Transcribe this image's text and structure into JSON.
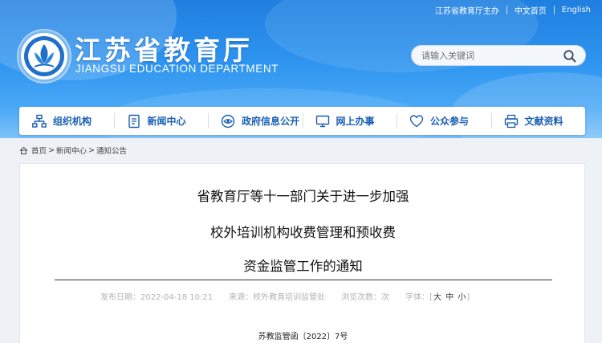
{
  "topbar": {
    "sponsor": "江苏省教育厅主办",
    "links": [
      "中文首页",
      "English"
    ]
  },
  "site": {
    "title": "江苏省教育厅",
    "subtitle": "JIANGSU EDUCATION DEPARTMENT"
  },
  "search": {
    "placeholder": "请输入关键词"
  },
  "nav": {
    "items": [
      {
        "label": "组织机构",
        "icon": "org-chart-icon"
      },
      {
        "label": "新闻中心",
        "icon": "document-icon"
      },
      {
        "label": "政府信息公开",
        "icon": "eye-icon"
      },
      {
        "label": "网上办事",
        "icon": "monitor-icon"
      },
      {
        "label": "公众参与",
        "icon": "heart-icon"
      },
      {
        "label": "文献资料",
        "icon": "printer-icon"
      }
    ]
  },
  "breadcrumb": {
    "items": [
      "首页",
      "新闻中心",
      "通知公告"
    ],
    "separator": ">"
  },
  "article": {
    "title_lines": [
      "省教育厅等十一部门关于进一步加强",
      "校外培训机构收费管理和预收费",
      "资金监管工作的通知"
    ],
    "meta": {
      "published": "发布日期：2022-04-18 10:21",
      "source": "来源：校外教育培训监管处",
      "views": "浏览次数：次",
      "font_label": "字体：",
      "font_bracket_open": "[",
      "font_sizes": [
        "大",
        "中",
        "小"
      ],
      "font_bracket_close": "]"
    },
    "doc_number": "苏教监管函〔2022〕7号"
  },
  "colors": {
    "header_blue": "#2e94ef",
    "nav_text": "#1a5fb4",
    "accent_gray": "#b3b3b3"
  }
}
